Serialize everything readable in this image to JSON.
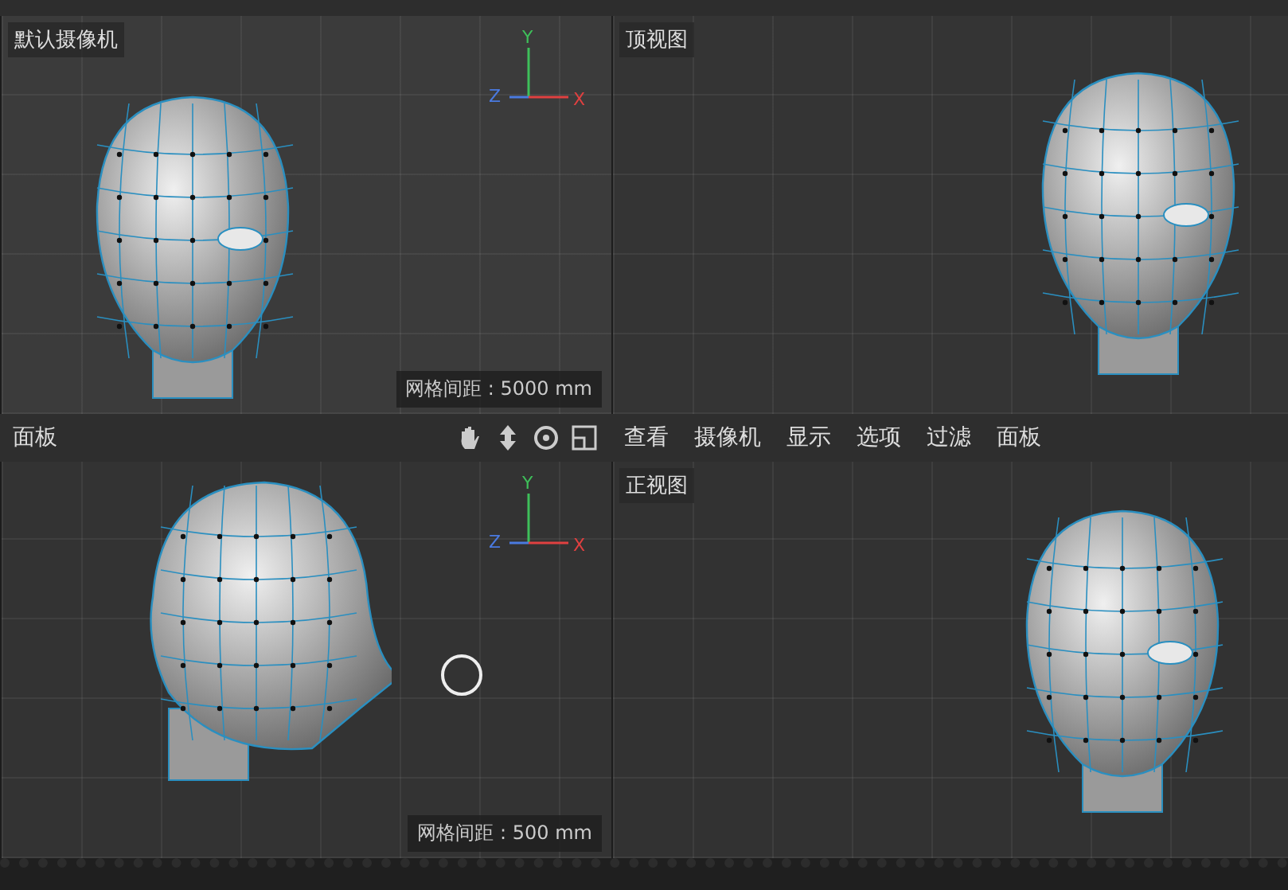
{
  "viewports": [
    {
      "kind": "perspective",
      "label": "默认摄像机",
      "grid_info": "网格间距 : 5000 mm",
      "axes": {
        "y": "Y",
        "z": "Z",
        "x": "X"
      }
    },
    {
      "kind": "top",
      "label": "顶视图"
    },
    {
      "kind": "side",
      "grid_info": "网格间距 : 500 mm",
      "axes": {
        "y": "Y",
        "z": "Z",
        "x": "X"
      }
    },
    {
      "kind": "front",
      "label": "正视图"
    }
  ],
  "left_header": {
    "menu": [
      "面板"
    ]
  },
  "right_header": {
    "menu": [
      "查看",
      "摄像机",
      "显示",
      "选项",
      "过滤",
      "面板"
    ]
  }
}
